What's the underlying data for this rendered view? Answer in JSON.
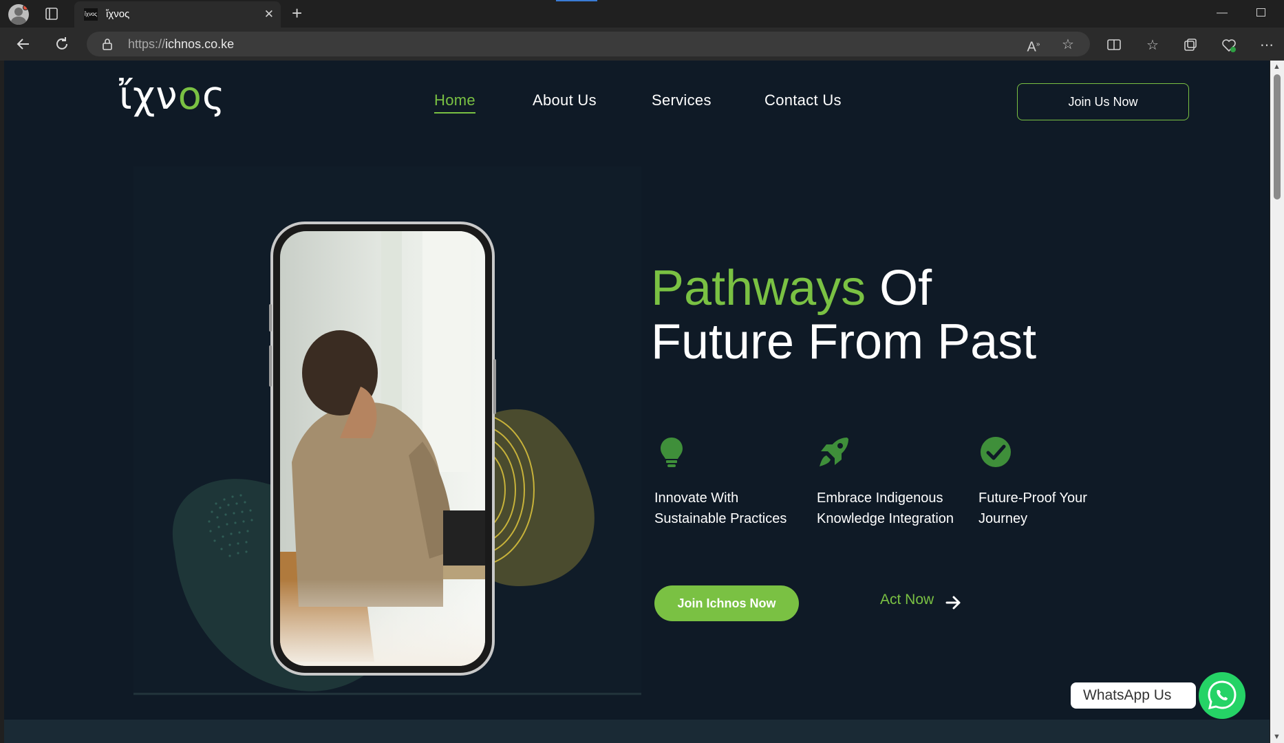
{
  "browser": {
    "tab_title": "ἴχνος",
    "favicon_text": "ἴχνος",
    "url_protocol": "https://",
    "url_host": "ichnos.co.ke",
    "icons": [
      "profile-icon",
      "tabs-icon",
      "close-icon",
      "new-tab-icon",
      "back-icon",
      "refresh-icon",
      "lock-icon",
      "read-aloud-icon",
      "favorite-star-icon",
      "split-screen-icon",
      "favorites-icon",
      "collections-icon",
      "browser-essentials-icon",
      "more-icon"
    ]
  },
  "site": {
    "logo_text": "ἴχνος",
    "nav": [
      {
        "label": "Home",
        "active": true
      },
      {
        "label": "About Us",
        "active": false
      },
      {
        "label": "Services",
        "active": false
      },
      {
        "label": "Contact Us",
        "active": false
      }
    ],
    "join_button": "Join Us Now"
  },
  "hero": {
    "headline_green": "Pathways",
    "headline_rest_1": " Of",
    "headline_line_2": "Future From Past",
    "features": [
      {
        "icon": "lightbulb-icon",
        "text": "Innovate With Sustainable Practices"
      },
      {
        "icon": "rocket-icon",
        "text": "Embrace Indigenous Knowledge Integration"
      },
      {
        "icon": "check-circle-icon",
        "text": "Future-Proof Your Journey"
      }
    ],
    "cta_primary": "Join Ichnos Now",
    "cta_secondary": "Act Now"
  },
  "whatsapp": {
    "label": "WhatsApp Us"
  },
  "colors": {
    "accent": "#7ac143",
    "background": "#0f1a26",
    "whatsapp": "#25d366"
  }
}
